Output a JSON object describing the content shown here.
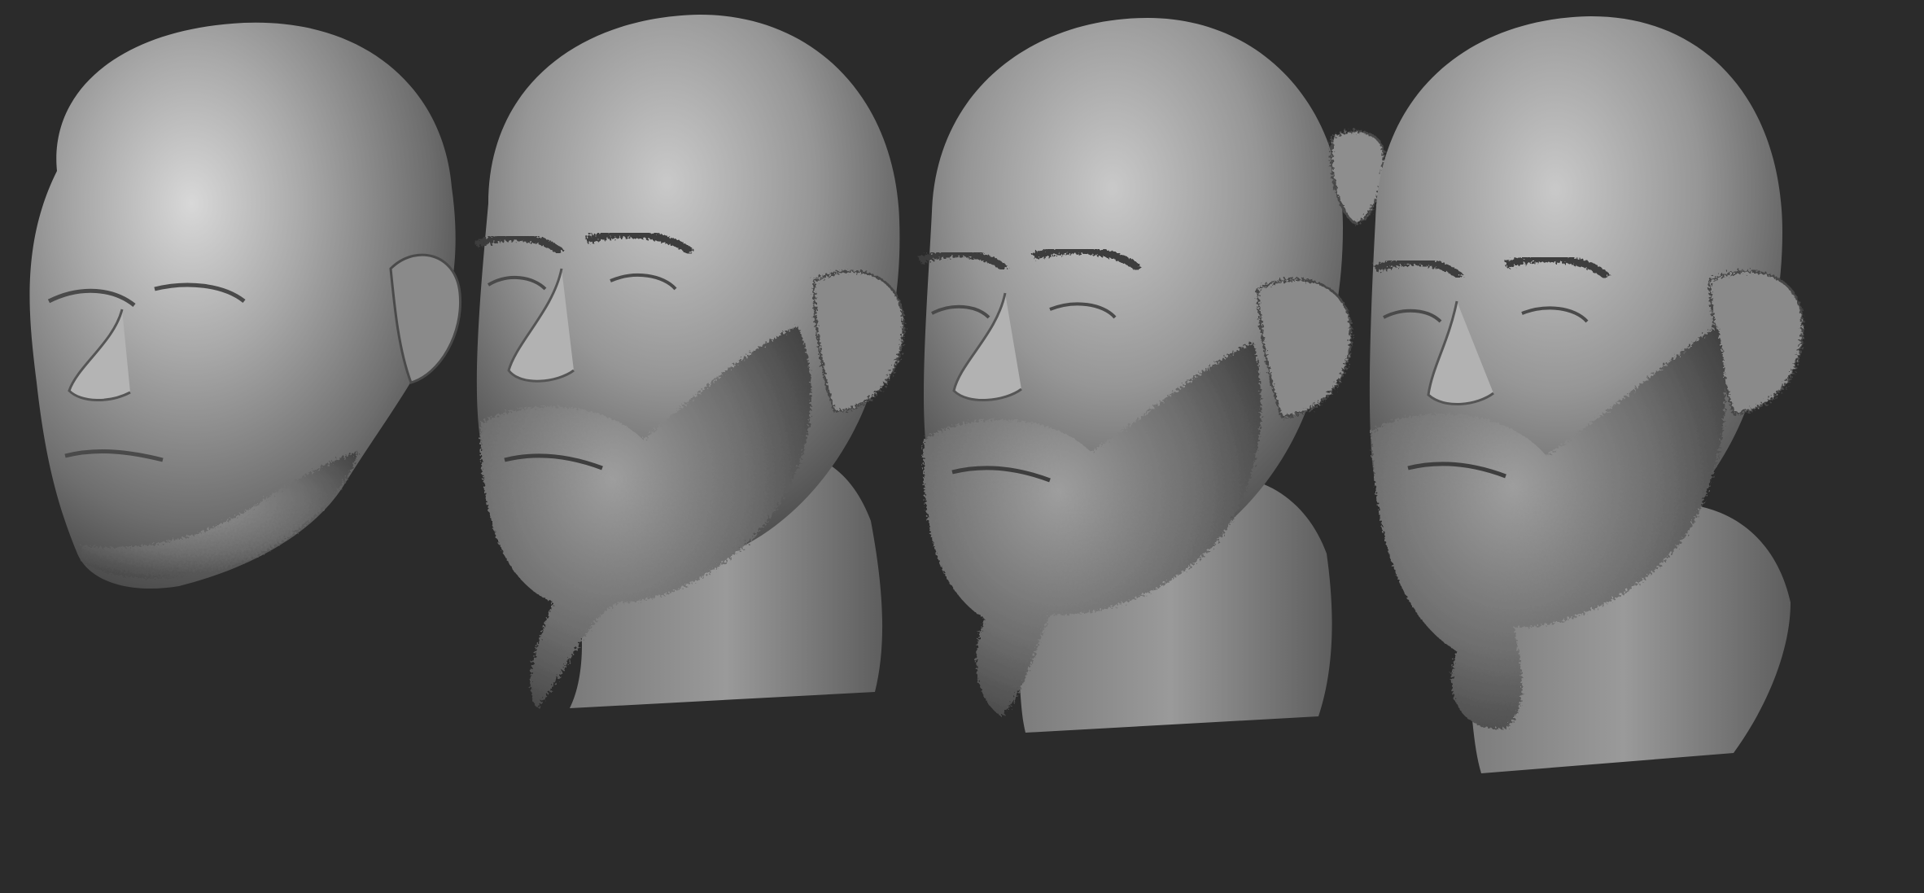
{
  "scene": {
    "background_color": "#2b2b2b",
    "sculpt_color": "#8f8f8f",
    "highlight_color": "#d4d4d4",
    "shadow_color": "#3a3a3a",
    "models": [
      {
        "id": "scan-1",
        "kind": "head-scan",
        "bearded": false,
        "has_neck": false
      },
      {
        "id": "scan-2",
        "kind": "head-scan",
        "bearded": true,
        "has_neck": true
      },
      {
        "id": "scan-3",
        "kind": "head-scan",
        "bearded": true,
        "has_neck": true
      },
      {
        "id": "scan-4",
        "kind": "head-scan",
        "bearded": true,
        "has_neck": true
      }
    ]
  }
}
